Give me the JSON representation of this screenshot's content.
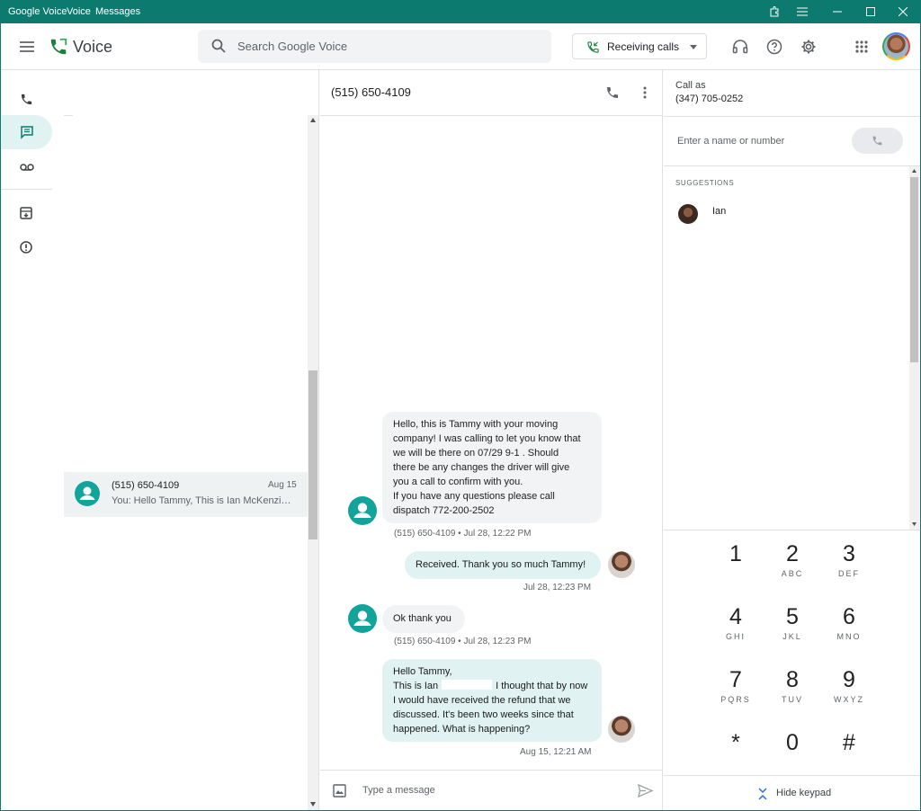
{
  "titlebar": {
    "app": "Google Voice",
    "crumb1": "Voice",
    "crumb2": "Messages"
  },
  "header": {
    "product": "Voice",
    "search_placeholder": "Search Google Voice",
    "receiving_label": "Receiving calls"
  },
  "colors": {
    "accent": "#0c7a6e",
    "teal": "#12a39b",
    "outbound_bubble": "#e0f2f1",
    "inbound_bubble": "#f1f3f4"
  },
  "conversation_list": [
    {
      "name": "(515) 650-4109",
      "date": "Aug 15",
      "snippet": "You: Hello Tammy, This is Ian McKenzi…"
    }
  ],
  "thread": {
    "title": "(515) 650-4109",
    "messages": [
      {
        "direction": "in",
        "lines": [
          "Hello, this is Tammy with your moving",
          "company! I was calling to let you know that",
          "we will be there on 07/29 9-1  .  Should",
          "there be any changes the driver will give",
          "you a call to confirm with you.",
          "If you have any questions please call",
          "dispatch 772-200-2502"
        ],
        "meta": "(515) 650-4109 • Jul 28, 12:22 PM"
      },
      {
        "direction": "out",
        "lines": [
          "Received. Thank you so much Tammy!"
        ],
        "meta": "Jul 28, 12:23 PM"
      },
      {
        "direction": "in",
        "lines": [
          "Ok thank you"
        ],
        "meta": "(515) 650-4109 • Jul 28, 12:23 PM"
      },
      {
        "direction": "out",
        "lines": [
          "Hello Tammy,",
          "This is Ian",
          "I thought that by now",
          "I would have received the refund that we",
          "discussed. It's been two weeks since that",
          "happened. What is happening?"
        ],
        "meta": "Aug 15, 12:21 AM"
      }
    ],
    "composer_placeholder": "Type a message"
  },
  "call_panel": {
    "call_as_label": "Call as",
    "call_as_number": "(347) 705-0252",
    "input_placeholder": "Enter a name or number",
    "suggestions_heading": "SUGGESTIONS",
    "suggestions": [
      {
        "name": "Ian"
      }
    ],
    "hide_keypad": "Hide keypad"
  },
  "keypad": [
    {
      "digit": "1",
      "letters": ""
    },
    {
      "digit": "2",
      "letters": "ABC"
    },
    {
      "digit": "3",
      "letters": "DEF"
    },
    {
      "digit": "4",
      "letters": "GHI"
    },
    {
      "digit": "5",
      "letters": "JKL"
    },
    {
      "digit": "6",
      "letters": "MNO"
    },
    {
      "digit": "7",
      "letters": "PQRS"
    },
    {
      "digit": "8",
      "letters": "TUV"
    },
    {
      "digit": "9",
      "letters": "WXYZ"
    },
    {
      "digit": "*",
      "letters": ""
    },
    {
      "digit": "0",
      "letters": ""
    },
    {
      "digit": "#",
      "letters": ""
    }
  ]
}
